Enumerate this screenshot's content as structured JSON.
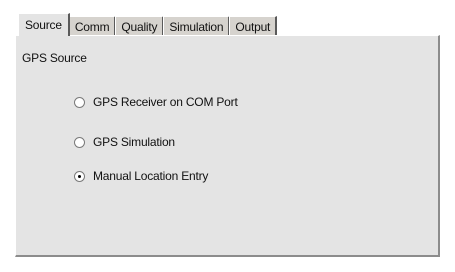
{
  "tabs": [
    {
      "label": "Source",
      "active": true
    },
    {
      "label": "Comm",
      "active": false
    },
    {
      "label": "Quality",
      "active": false
    },
    {
      "label": "Simulation",
      "active": false
    },
    {
      "label": "Output",
      "active": false
    }
  ],
  "group_label": "GPS Source",
  "options": [
    {
      "label": "GPS Receiver on COM Port",
      "selected": false
    },
    {
      "label": "GPS Simulation",
      "selected": false
    },
    {
      "label": "Manual Location Entry",
      "selected": true
    }
  ],
  "colors": {
    "panel_background": "#e4e4e4",
    "tab_background": "#d6d3ce"
  }
}
